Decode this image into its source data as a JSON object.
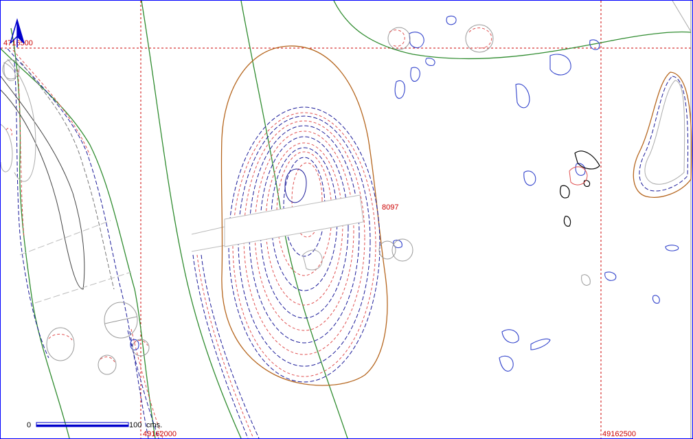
{
  "map": {
    "grid_labels": {
      "northing_top_left": "4716500",
      "easting_bottom_left": "49162000",
      "easting_bottom_right": "49162500"
    },
    "contour_label": "8097",
    "scale_bar": {
      "start_label": "0",
      "end_label": "100",
      "unit_label": "cms."
    },
    "north_arrow_icon": "north-arrow-icon",
    "colors": {
      "grid": "#cc0000",
      "river_green": "#2e8b2e",
      "outline_brown": "#b5651d",
      "contour_blue": "#1a1a99",
      "contour_red": "#e05050",
      "stone_blue": "#3344cc",
      "stone_gray": "#999999",
      "frame": "#0000ff"
    }
  }
}
